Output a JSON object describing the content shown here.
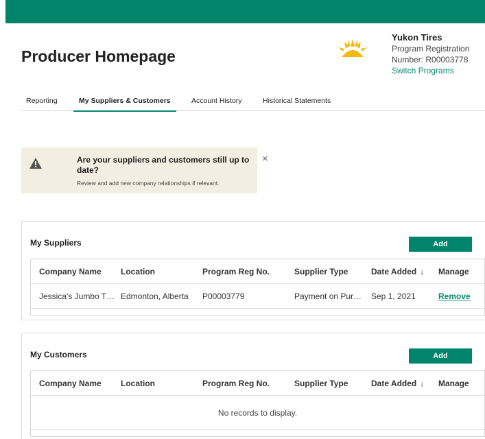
{
  "header": {
    "page_title": "Producer Homepage",
    "brand_color": "#00846b",
    "logo_icon": "sun-icon"
  },
  "account": {
    "company": "Yukon Tires",
    "line1": "Program Registration",
    "line2": "Number: R00003778",
    "switch_label": "Switch Programs"
  },
  "tabs": [
    {
      "label": "Reporting",
      "active": false
    },
    {
      "label": "My Suppliers & Customers",
      "active": true
    },
    {
      "label": "Account History",
      "active": false
    },
    {
      "label": "Historical Statements",
      "active": false
    }
  ],
  "alert": {
    "icon": "warning-icon",
    "title": "Are your suppliers and customers still up to date?",
    "subtitle": "Review and add new company relationships if relevant.",
    "close_icon": "close-icon"
  },
  "suppliers": {
    "title": "My Suppliers",
    "add_label": "Add",
    "columns": [
      "Company Name",
      "Location",
      "Program Reg No.",
      "Supplier Type",
      "Date Added",
      "Manage"
    ],
    "rows": [
      {
        "company": "Jessica's Jumbo T…",
        "location": "Edmonton, Alberta",
        "reg_no": "P00003779",
        "type": "Payment on Pur…",
        "date": "Sep 1, 2021",
        "action": "Remove"
      }
    ]
  },
  "customers": {
    "title": "My Customers",
    "add_label": "Add",
    "columns": [
      "Company Name",
      "Location",
      "Program Reg No.",
      "Supplier Type",
      "Date Added",
      "Manage"
    ],
    "empty_text": "No records to display."
  },
  "sort_icon": "arrow-down-icon"
}
